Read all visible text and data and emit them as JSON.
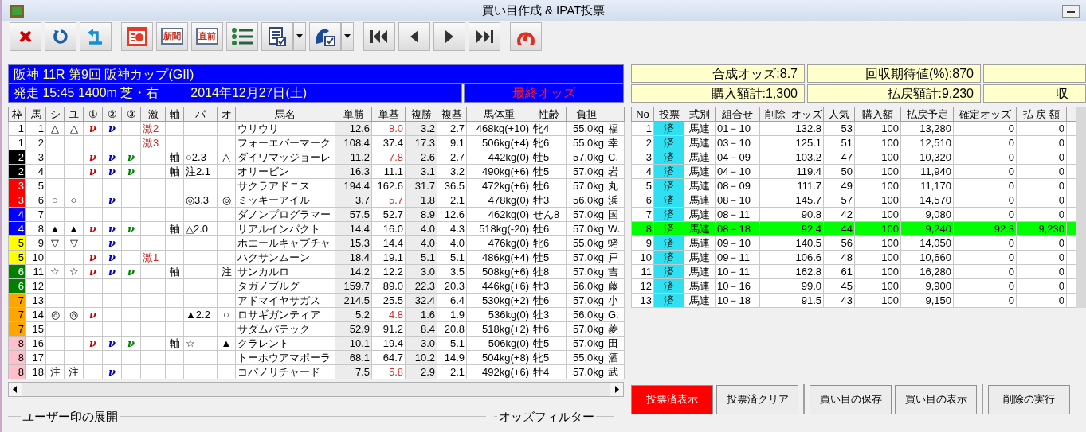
{
  "window": {
    "title": "買い目作成 & IPAT投票"
  },
  "toolbar": [
    {
      "kind": "close"
    },
    {
      "kind": "refresh"
    },
    {
      "kind": "return"
    },
    {
      "kind": "chart"
    },
    {
      "kind": "text",
      "label": "新聞"
    },
    {
      "kind": "text",
      "label": "直前"
    },
    {
      "kind": "list"
    },
    {
      "kind": "document",
      "dropdown": true
    },
    {
      "kind": "horse",
      "dropdown": true
    },
    {
      "kind": "first"
    },
    {
      "kind": "prev"
    },
    {
      "kind": "next"
    },
    {
      "kind": "last"
    },
    {
      "kind": "horseshoe"
    }
  ],
  "race": {
    "title": "阪神 11R 第9回 阪神カップ(GII)",
    "start": "発走 15:45 1400m 芝・右",
    "date": "2014年12月27日(土)",
    "odds_status": "最終オッズ"
  },
  "entries": {
    "columns": [
      "枠",
      "馬",
      "シ",
      "ユ",
      "①",
      "②",
      "③",
      "激",
      "軸",
      "パ",
      "オ",
      "馬名",
      "単勝",
      "単基",
      "複勝",
      "複基",
      "馬体重",
      "性齢",
      "負担"
    ],
    "rows": [
      {
        "waku": "1",
        "color": "#ffffff",
        "uma": "1",
        "shi": "△",
        "yu": "△",
        "m1": "ν",
        "m2": "ν",
        "geki": "激2",
        "name": "ウリウリ",
        "tansho": "12.6",
        "tanki": "8.0",
        "tanki_alert": true,
        "fukusho": "3.2",
        "fukuki": "2.7",
        "weight": "468kg(+10)",
        "sex_age": "牝4",
        "burden": "55.0kg",
        "jockey": "福"
      },
      {
        "waku": "1",
        "color": "#ffffff",
        "uma": "2",
        "geki": "激3",
        "name": "フォーエバーマーク",
        "tansho": "108.4",
        "tanki": "37.4",
        "tanki_alert": false,
        "fukusho": "17.3",
        "fukuki": "9.1",
        "weight": "506kg(+4)",
        "sex_age": "牝6",
        "burden": "55.0kg",
        "jockey": "幸"
      },
      {
        "waku": "2",
        "color": "#000000",
        "uma": "3",
        "m1": "ν",
        "m2": "ν",
        "m3": "ν",
        "jiku": "軸",
        "pa": "○2.3",
        "o": "△",
        "name": "ダイワマッジョーレ",
        "tansho": "11.2",
        "tanki": "7.8",
        "tanki_alert": true,
        "fukusho": "2.6",
        "fukuki": "2.7",
        "weight": "442kg(0)",
        "sex_age": "牡5",
        "burden": "57.0kg",
        "jockey": "C."
      },
      {
        "waku": "2",
        "color": "#000000",
        "uma": "4",
        "m1": "ν",
        "m2": "ν",
        "m3": "ν",
        "jiku": "軸",
        "pa": "注2.1",
        "name": "オリービン",
        "tansho": "16.3",
        "tanki": "11.1",
        "tanki_alert": false,
        "fukusho": "3.1",
        "fukuki": "3.2",
        "weight": "490kg(+6)",
        "sex_age": "牡5",
        "burden": "57.0kg",
        "jockey": "岩"
      },
      {
        "waku": "3",
        "color": "#ff0000",
        "uma": "5",
        "name": "サクラアドニス",
        "tansho": "194.4",
        "tanki": "162.6",
        "tanki_alert": false,
        "fukusho": "31.7",
        "fukuki": "36.5",
        "weight": "472kg(+6)",
        "sex_age": "牡6",
        "burden": "57.0kg",
        "jockey": "丸"
      },
      {
        "waku": "3",
        "color": "#ff0000",
        "uma": "6",
        "shi": "○",
        "yu": "○",
        "m2": "ν",
        "pa": "◎3.3",
        "o": "◎",
        "name": "ミッキーアイル",
        "tansho": "3.7",
        "tanki": "5.7",
        "tanki_alert": true,
        "fukusho": "1.8",
        "fukuki": "2.1",
        "weight": "478kg(0)",
        "sex_age": "牡3",
        "burden": "56.0kg",
        "jockey": "浜"
      },
      {
        "waku": "4",
        "color": "#0000ff",
        "uma": "7",
        "name": "ダノンプログラマー",
        "tansho": "57.5",
        "tanki": "52.7",
        "tanki_alert": false,
        "fukusho": "8.9",
        "fukuki": "12.6",
        "weight": "462kg(0)",
        "sex_age": "せん8",
        "burden": "57.0kg",
        "jockey": "国"
      },
      {
        "waku": "4",
        "color": "#0000ff",
        "uma": "8",
        "shi": "▲",
        "yu": "▲",
        "m1": "ν",
        "m2": "ν",
        "m3": "ν",
        "jiku": "軸",
        "pa": "△2.0",
        "name": "リアルインパクト",
        "tansho": "14.4",
        "tanki": "16.0",
        "tanki_alert": false,
        "fukusho": "4.0",
        "fukuki": "4.3",
        "weight": "518kg(-20)",
        "sex_age": "牡6",
        "burden": "57.0kg",
        "jockey": "W."
      },
      {
        "waku": "5",
        "color": "#ffff00",
        "uma": "9",
        "shi": "▽",
        "yu": "▽",
        "m2": "ν",
        "name": "ホエールキャプチャ",
        "tansho": "15.3",
        "tanki": "14.4",
        "tanki_alert": false,
        "fukusho": "4.0",
        "fukuki": "4.0",
        "weight": "476kg(0)",
        "sex_age": "牝6",
        "burden": "55.0kg",
        "jockey": "蛯"
      },
      {
        "waku": "5",
        "color": "#ffff00",
        "uma": "10",
        "m1": "ν",
        "m2": "ν",
        "geki": "激1",
        "name": "ハクサンムーン",
        "tansho": "18.4",
        "tanki": "19.1",
        "tanki_alert": false,
        "fukusho": "5.1",
        "fukuki": "5.1",
        "weight": "486kg(+4)",
        "sex_age": "牡5",
        "burden": "57.0kg",
        "jockey": "戸"
      },
      {
        "waku": "6",
        "color": "#008000",
        "uma": "11",
        "shi": "☆",
        "yu": "☆",
        "m1": "ν",
        "m2": "ν",
        "m3": "ν",
        "jiku": "軸",
        "o": "注",
        "name": "サンカルロ",
        "tansho": "14.2",
        "tanki": "12.2",
        "tanki_alert": false,
        "fukusho": "3.0",
        "fukuki": "3.5",
        "weight": "508kg(+6)",
        "sex_age": "牡8",
        "burden": "57.0kg",
        "jockey": "吉"
      },
      {
        "waku": "6",
        "color": "#008000",
        "uma": "12",
        "name": "タガノブルグ",
        "tansho": "159.7",
        "tanki": "89.0",
        "tanki_alert": false,
        "fukusho": "22.3",
        "fukuki": "20.3",
        "weight": "446kg(+6)",
        "sex_age": "牡3",
        "burden": "56.0kg",
        "jockey": "藤"
      },
      {
        "waku": "7",
        "color": "#ffa500",
        "uma": "13",
        "name": "アドマイヤサガス",
        "tansho": "214.5",
        "tanki": "25.5",
        "tanki_alert": false,
        "fukusho": "32.4",
        "fukuki": "6.4",
        "weight": "530kg(+2)",
        "sex_age": "牡6",
        "burden": "57.0kg",
        "jockey": "小"
      },
      {
        "waku": "7",
        "color": "#ffa500",
        "uma": "14",
        "shi": "◎",
        "yu": "◎",
        "m1": "ν",
        "pa": "▲2.2",
        "o": "○",
        "name": "ロサギガンティア",
        "tansho": "5.2",
        "tanki": "4.8",
        "tanki_alert": true,
        "fukusho": "1.6",
        "fukuki": "1.9",
        "weight": "536kg(0)",
        "sex_age": "牡3",
        "burden": "56.0kg",
        "jockey": "G."
      },
      {
        "waku": "7",
        "color": "#ffa500",
        "uma": "15",
        "name": "サダムパテック",
        "tansho": "52.9",
        "tanki": "91.2",
        "tanki_alert": false,
        "fukusho": "8.4",
        "fukuki": "20.8",
        "weight": "518kg(+2)",
        "sex_age": "牡6",
        "burden": "57.0kg",
        "jockey": "菱"
      },
      {
        "waku": "8",
        "color": "#ffc0cb",
        "uma": "16",
        "m1": "ν",
        "m2": "ν",
        "m3": "ν",
        "jiku": "軸",
        "pa": "☆",
        "o": "▲",
        "name": "クラレント",
        "tansho": "10.1",
        "tanki": "19.4",
        "tanki_alert": false,
        "fukusho": "3.0",
        "fukuki": "5.1",
        "weight": "506kg(0)",
        "sex_age": "牡5",
        "burden": "57.0kg",
        "jockey": "田"
      },
      {
        "waku": "8",
        "color": "#ffc0cb",
        "uma": "17",
        "name": "トーホウアマポーラ",
        "tansho": "68.1",
        "tanki": "64.7",
        "tanki_alert": false,
        "fukusho": "10.2",
        "fukuki": "14.9",
        "weight": "504kg(+8)",
        "sex_age": "牝5",
        "burden": "55.0kg",
        "jockey": "酒"
      },
      {
        "waku": "8",
        "color": "#ffc0cb",
        "uma": "18",
        "shi": "注",
        "yu": "注",
        "m2": "ν",
        "name": "コパノリチャード",
        "tansho": "7.5",
        "tanki": "5.8",
        "tanki_alert": true,
        "fukusho": "2.9",
        "fukuki": "2.1",
        "weight": "492kg(+6)",
        "sex_age": "牡4",
        "burden": "57.0kg",
        "jockey": "武"
      }
    ]
  },
  "summary": [
    [
      "合成オッズ:8.7",
      "回収期待値(%):870"
    ],
    [
      "購入額計:1,300",
      "払戻額計:9,230",
      "収"
    ]
  ],
  "bets": {
    "columns": [
      "No",
      "投票",
      "式別",
      "組合せ",
      "削除",
      "オッズ",
      "人気",
      "購入額",
      "払戻予定",
      "確定オッズ",
      "払 戻 額"
    ],
    "rows": [
      {
        "no": "1",
        "vote": "済",
        "type": "馬連",
        "combo": "01－10",
        "odds": "132.8",
        "pop": "53",
        "amount": "100",
        "estimate": "13,280",
        "final_odds": "0",
        "payout": "0",
        "selected": false
      },
      {
        "no": "2",
        "vote": "済",
        "type": "馬連",
        "combo": "03－10",
        "odds": "125.1",
        "pop": "51",
        "amount": "100",
        "estimate": "12,510",
        "final_odds": "0",
        "payout": "0",
        "selected": false
      },
      {
        "no": "3",
        "vote": "済",
        "type": "馬連",
        "combo": "04－09",
        "odds": "103.2",
        "pop": "47",
        "amount": "100",
        "estimate": "10,320",
        "final_odds": "0",
        "payout": "0",
        "selected": false
      },
      {
        "no": "4",
        "vote": "済",
        "type": "馬連",
        "combo": "04－10",
        "odds": "119.4",
        "pop": "50",
        "amount": "100",
        "estimate": "11,940",
        "final_odds": "0",
        "payout": "0",
        "selected": false
      },
      {
        "no": "5",
        "vote": "済",
        "type": "馬連",
        "combo": "08－09",
        "odds": "111.7",
        "pop": "49",
        "amount": "100",
        "estimate": "11,170",
        "final_odds": "0",
        "payout": "0",
        "selected": false
      },
      {
        "no": "6",
        "vote": "済",
        "type": "馬連",
        "combo": "08－10",
        "odds": "145.7",
        "pop": "57",
        "amount": "100",
        "estimate": "14,570",
        "final_odds": "0",
        "payout": "0",
        "selected": false
      },
      {
        "no": "7",
        "vote": "済",
        "type": "馬連",
        "combo": "08－11",
        "odds": "90.8",
        "pop": "42",
        "amount": "100",
        "estimate": "9,080",
        "final_odds": "0",
        "payout": "0",
        "selected": false
      },
      {
        "no": "8",
        "vote": "済",
        "type": "馬連",
        "combo": "08－18",
        "odds": "92.4",
        "pop": "44",
        "amount": "100",
        "estimate": "9,240",
        "final_odds": "92.3",
        "payout": "9,230",
        "selected": true
      },
      {
        "no": "9",
        "vote": "済",
        "type": "馬連",
        "combo": "09－10",
        "odds": "140.5",
        "pop": "56",
        "amount": "100",
        "estimate": "14,050",
        "final_odds": "0",
        "payout": "0",
        "selected": false
      },
      {
        "no": "10",
        "vote": "済",
        "type": "馬連",
        "combo": "09－11",
        "odds": "106.6",
        "pop": "48",
        "amount": "100",
        "estimate": "10,660",
        "final_odds": "0",
        "payout": "0",
        "selected": false
      },
      {
        "no": "11",
        "vote": "済",
        "type": "馬連",
        "combo": "10－11",
        "odds": "162.8",
        "pop": "61",
        "amount": "100",
        "estimate": "16,280",
        "final_odds": "0",
        "payout": "0",
        "selected": false
      },
      {
        "no": "12",
        "vote": "済",
        "type": "馬連",
        "combo": "10－16",
        "odds": "99.0",
        "pop": "45",
        "amount": "100",
        "estimate": "9,900",
        "final_odds": "0",
        "payout": "0",
        "selected": false
      },
      {
        "no": "13",
        "vote": "済",
        "type": "馬連",
        "combo": "10－18",
        "odds": "91.5",
        "pop": "43",
        "amount": "100",
        "estimate": "9,150",
        "final_odds": "0",
        "payout": "0",
        "selected": false
      }
    ]
  },
  "actions": [
    {
      "label": "投票済表示",
      "active": true
    },
    {
      "label": "投票済クリア",
      "active": false
    },
    {
      "label": "買い目の保存",
      "active": false
    },
    {
      "label": "買い目の表示",
      "active": false
    },
    {
      "label": "削除の実行",
      "active": false
    }
  ],
  "groups": [
    "ユーザー印の展開",
    "オッズフィルター"
  ]
}
